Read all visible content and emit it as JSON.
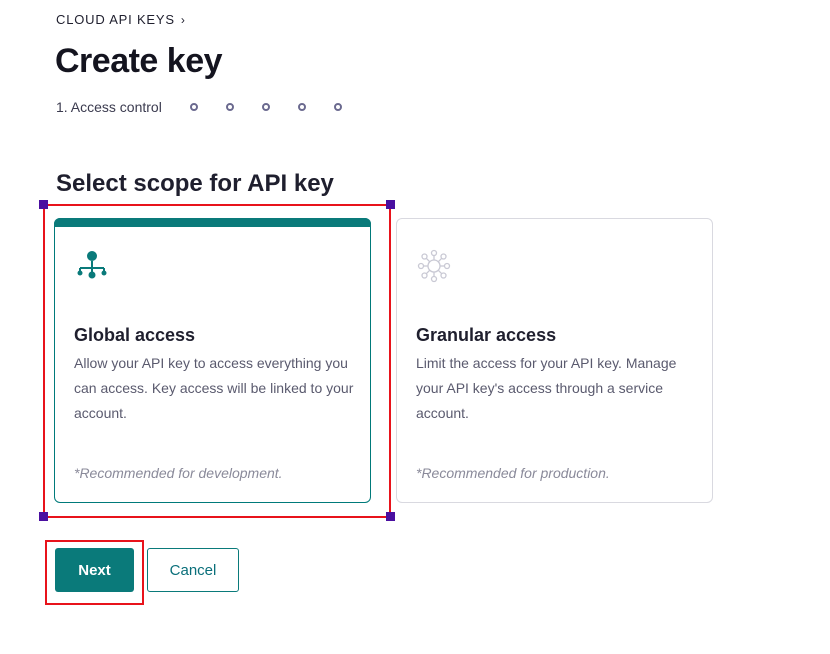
{
  "breadcrumb": {
    "label": "CLOUD API KEYS",
    "chevron": "›"
  },
  "header": {
    "title": "Create key"
  },
  "stepper": {
    "current_label": "1. Access control",
    "remaining_steps": 5
  },
  "section": {
    "title": "Select scope for API key"
  },
  "cards": [
    {
      "id": "global",
      "title": "Global access",
      "description": "Allow your API key to access everything you can access. Key access will be linked to your account.",
      "note": "*Recommended for development.",
      "icon": "hierarchy-icon",
      "selected": true
    },
    {
      "id": "granular",
      "title": "Granular access",
      "description": "Limit the access for your API key. Manage your API key's access through a service account.",
      "note": "*Recommended for production.",
      "icon": "network-icon",
      "selected": false
    }
  ],
  "actions": {
    "next_label": "Next",
    "cancel_label": "Cancel"
  },
  "colors": {
    "accent": "#0a7a7a",
    "highlight": "#e8131b",
    "handle": "#4a0fa0"
  }
}
